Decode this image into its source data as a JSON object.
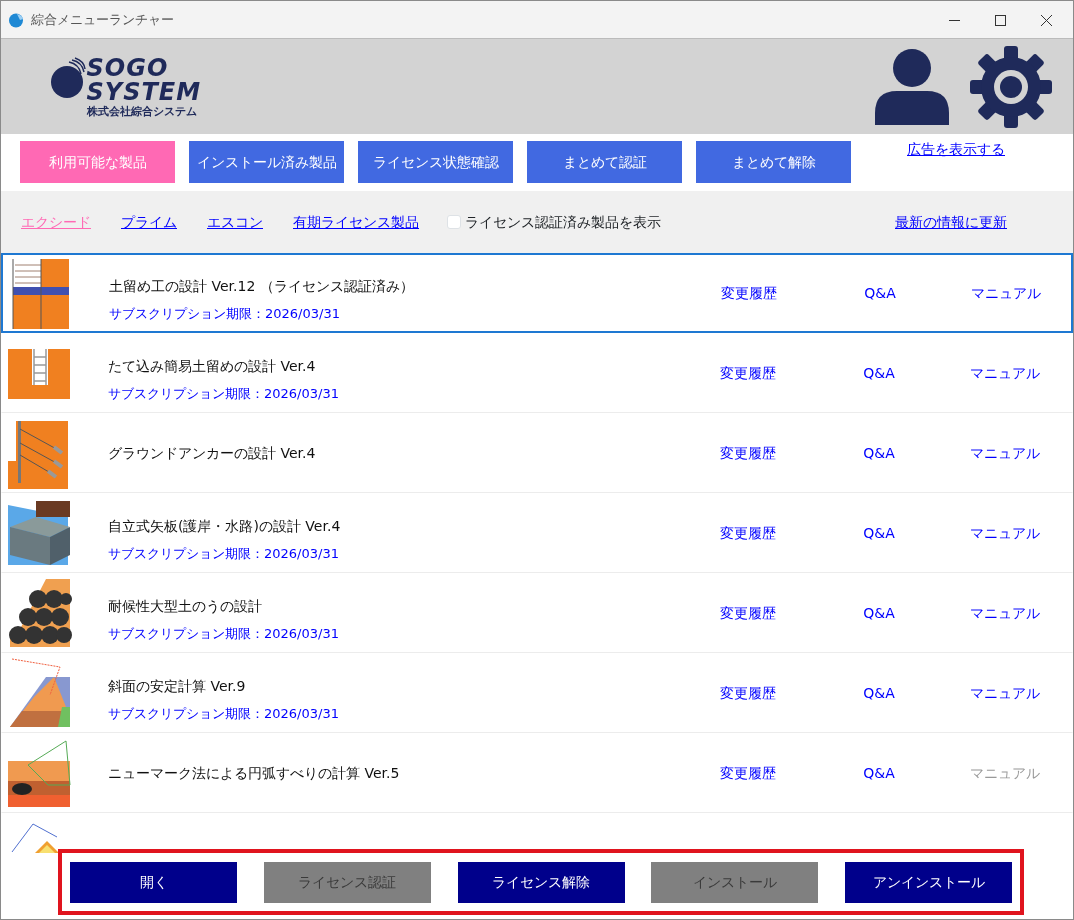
{
  "window": {
    "title": "綜合メニューランチャー"
  },
  "logo": {
    "line_1": "SOGO",
    "line_2": "SYSTEM",
    "company": "株式会社綜合システム"
  },
  "tabs": [
    {
      "label": "利用可能な製品",
      "selected": true
    },
    {
      "label": "インストール済み製品",
      "selected": false
    },
    {
      "label": "ライセンス状態確認",
      "selected": false
    },
    {
      "label": "まとめて認証",
      "selected": false
    },
    {
      "label": "まとめて解除",
      "selected": false
    }
  ],
  "ad_link": "広告を表示する",
  "filters": [
    {
      "label": "エクシード",
      "selected": true
    },
    {
      "label": "プライム",
      "selected": false
    },
    {
      "label": "エスコン",
      "selected": false
    },
    {
      "label": "有期ライセンス製品",
      "selected": false
    }
  ],
  "show_licensed": {
    "label": "ライセンス認証済み製品を表示",
    "checked": false
  },
  "refresh_link": "最新の情報に更新",
  "products": [
    {
      "kind": "retaining-wall",
      "name": "土留め工の設計 Ver.12 （ライセンス認証済み）",
      "subscription": "サブスクリプション期限：2026/03/31",
      "selected": true,
      "history": "変更履歴",
      "qa": "Q&A",
      "manual": {
        "label": "マニュアル",
        "disabled": false
      }
    },
    {
      "kind": "trench",
      "name": "たて込み簡易土留めの設計 Ver.4",
      "subscription": "サブスクリプション期限：2026/03/31",
      "selected": false,
      "history": "変更履歴",
      "qa": "Q&A",
      "manual": {
        "label": "マニュアル",
        "disabled": false
      }
    },
    {
      "kind": "anchor",
      "name": "グラウンドアンカーの設計 Ver.4",
      "selected": false,
      "history": "変更履歴",
      "qa": "Q&A",
      "manual": {
        "label": "マニュアル",
        "disabled": false
      }
    },
    {
      "kind": "sheet-pile",
      "name": "自立式矢板(護岸・水路)の設計 Ver.4",
      "subscription": "サブスクリプション期限：2026/03/31",
      "selected": false,
      "history": "変更履歴",
      "qa": "Q&A",
      "manual": {
        "label": "マニュアル",
        "disabled": false
      }
    },
    {
      "kind": "sandbag",
      "name": "耐候性大型土のうの設計",
      "subscription": "サブスクリプション期限：2026/03/31",
      "selected": false,
      "history": "変更履歴",
      "qa": "Q&A",
      "manual": {
        "label": "マニュアル",
        "disabled": false
      }
    },
    {
      "kind": "slope",
      "name": "斜面の安定計算 Ver.9",
      "subscription": "サブスクリプション期限：2026/03/31",
      "selected": false,
      "history": "変更履歴",
      "qa": "Q&A",
      "manual": {
        "label": "マニュアル",
        "disabled": false
      }
    },
    {
      "kind": "newmark",
      "name": "ニューマーク法による円弧すべりの計算 Ver.5",
      "selected": false,
      "history": "変更履歴",
      "qa": "Q&A",
      "manual": {
        "label": "マニュアル",
        "disabled": true
      }
    }
  ],
  "actions": [
    {
      "label": "開く",
      "disabled": false
    },
    {
      "label": "ライセンス認証",
      "disabled": true
    },
    {
      "label": "ライセンス解除",
      "disabled": false
    },
    {
      "label": "インストール",
      "disabled": true
    },
    {
      "label": "アンインストール",
      "disabled": false
    }
  ]
}
